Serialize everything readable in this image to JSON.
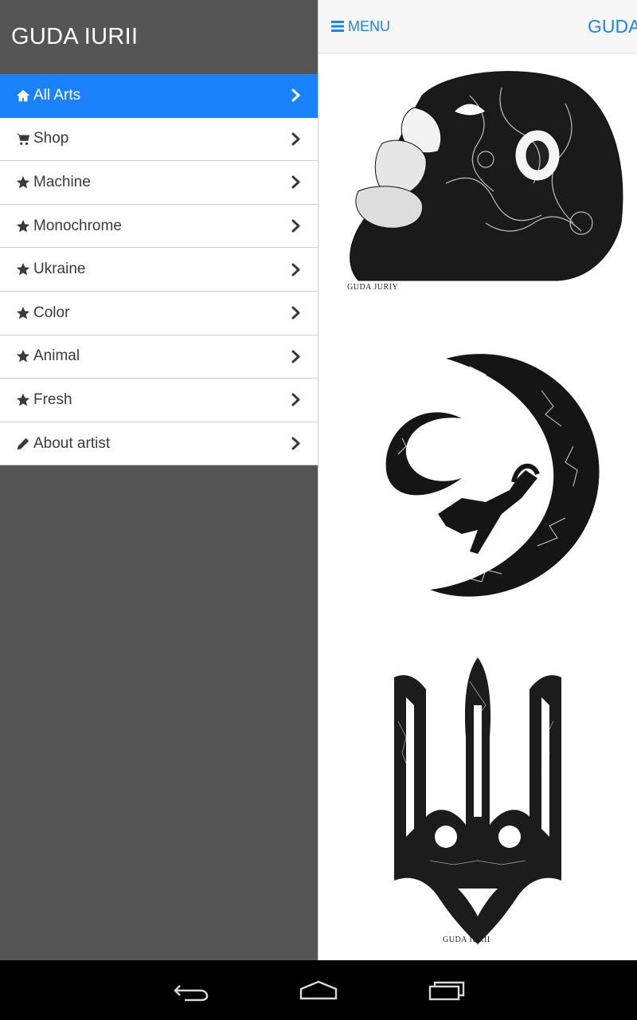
{
  "drawer": {
    "title": "GUDA IURII",
    "items": [
      {
        "label": "All Arts",
        "icon": "home-icon",
        "active": true
      },
      {
        "label": "Shop",
        "icon": "cart-icon",
        "active": false
      },
      {
        "label": "Machine",
        "icon": "star-icon",
        "active": false
      },
      {
        "label": "Monochrome",
        "icon": "star-icon",
        "active": false
      },
      {
        "label": "Ukraine",
        "icon": "star-icon",
        "active": false
      },
      {
        "label": "Color",
        "icon": "star-icon",
        "active": false
      },
      {
        "label": "Animal",
        "icon": "star-icon",
        "active": false
      },
      {
        "label": "Fresh",
        "icon": "star-icon",
        "active": false
      },
      {
        "label": "About artist",
        "icon": "pencil-icon",
        "active": false
      }
    ]
  },
  "topbar": {
    "menu_label": "MENU",
    "brand": "GUDA"
  },
  "gallery": [
    {
      "subject": "monkey-artwork",
      "signature": "GUDA JURIY"
    },
    {
      "subject": "crescent-moon-fox-artwork",
      "signature": ""
    },
    {
      "subject": "trident-artwork",
      "signature": "GUDA IURII"
    }
  ],
  "colors": {
    "accent": "#1a82fb",
    "drawer_bg": "#555555",
    "navbar_bg": "#000000"
  },
  "system_nav": [
    "back-icon",
    "home-icon",
    "recent-apps-icon"
  ]
}
